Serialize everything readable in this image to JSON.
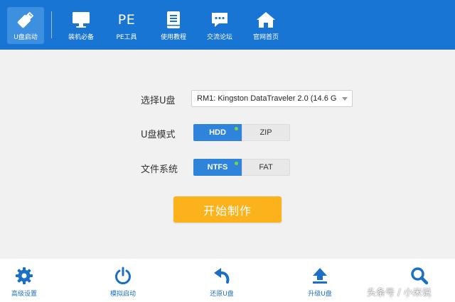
{
  "top_nav": [
    {
      "label": "U盘启动",
      "icon": "usb-drive-icon",
      "active": true
    },
    {
      "label": "装机必备",
      "icon": "monitor-icon",
      "active": false
    },
    {
      "label": "PE工具",
      "icon": "pe-text-icon",
      "icon_text": "PE",
      "active": false
    },
    {
      "label": "使用教程",
      "icon": "book-icon",
      "active": false
    },
    {
      "label": "交流论坛",
      "icon": "chat-bubble-icon",
      "active": false
    },
    {
      "label": "官网首页",
      "icon": "home-icon",
      "active": false
    }
  ],
  "form": {
    "select_disk_label": "选择U盘",
    "select_disk_value": "RM1: Kingston DataTraveler 2.0 (14.6 G",
    "usb_mode_label": "U盘模式",
    "usb_mode_options": [
      "HDD",
      "ZIP"
    ],
    "usb_mode_selected": "HDD",
    "fs_label": "文件系统",
    "fs_options": [
      "NTFS",
      "FAT"
    ],
    "fs_selected": "NTFS",
    "start_button": "开始制作"
  },
  "bottom_nav": [
    {
      "label": "高级设置",
      "icon": "gear-icon"
    },
    {
      "label": "模拟启动",
      "icon": "power-icon"
    },
    {
      "label": "还原U盘",
      "icon": "undo-arrow-icon"
    },
    {
      "label": "升级U盘",
      "icon": "upload-icon"
    },
    {
      "label": "U盘搜索",
      "icon": "search-icon"
    }
  ],
  "watermark": "头条号 / 小米说",
  "colors": {
    "primary_blue": "#1875d3",
    "accent_orange": "#fbb21b",
    "selected_indicator_green": "#7dd63b",
    "bottom_icon_blue": "#1b6fc6"
  }
}
